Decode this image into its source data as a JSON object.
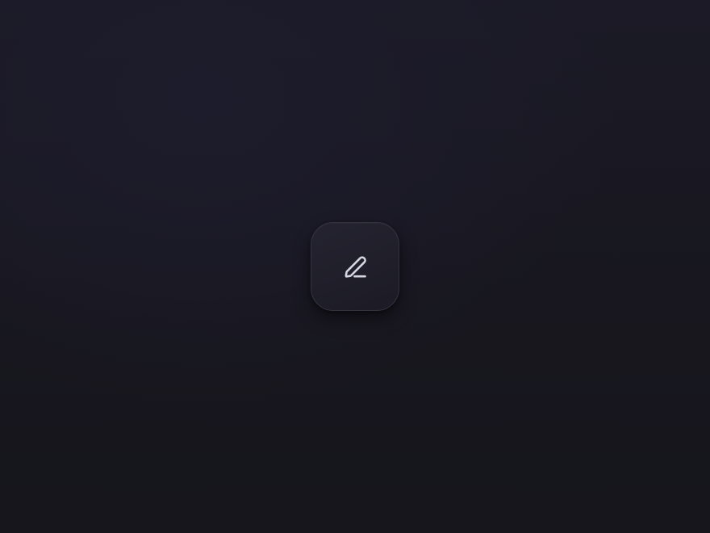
{
  "edit_button": {
    "icon": "pencil-edit-icon",
    "icon_color": "#d4d6e2",
    "tile_border_color": "#33323e",
    "tile_background": "#201f2a"
  },
  "background_color": "#18171f"
}
